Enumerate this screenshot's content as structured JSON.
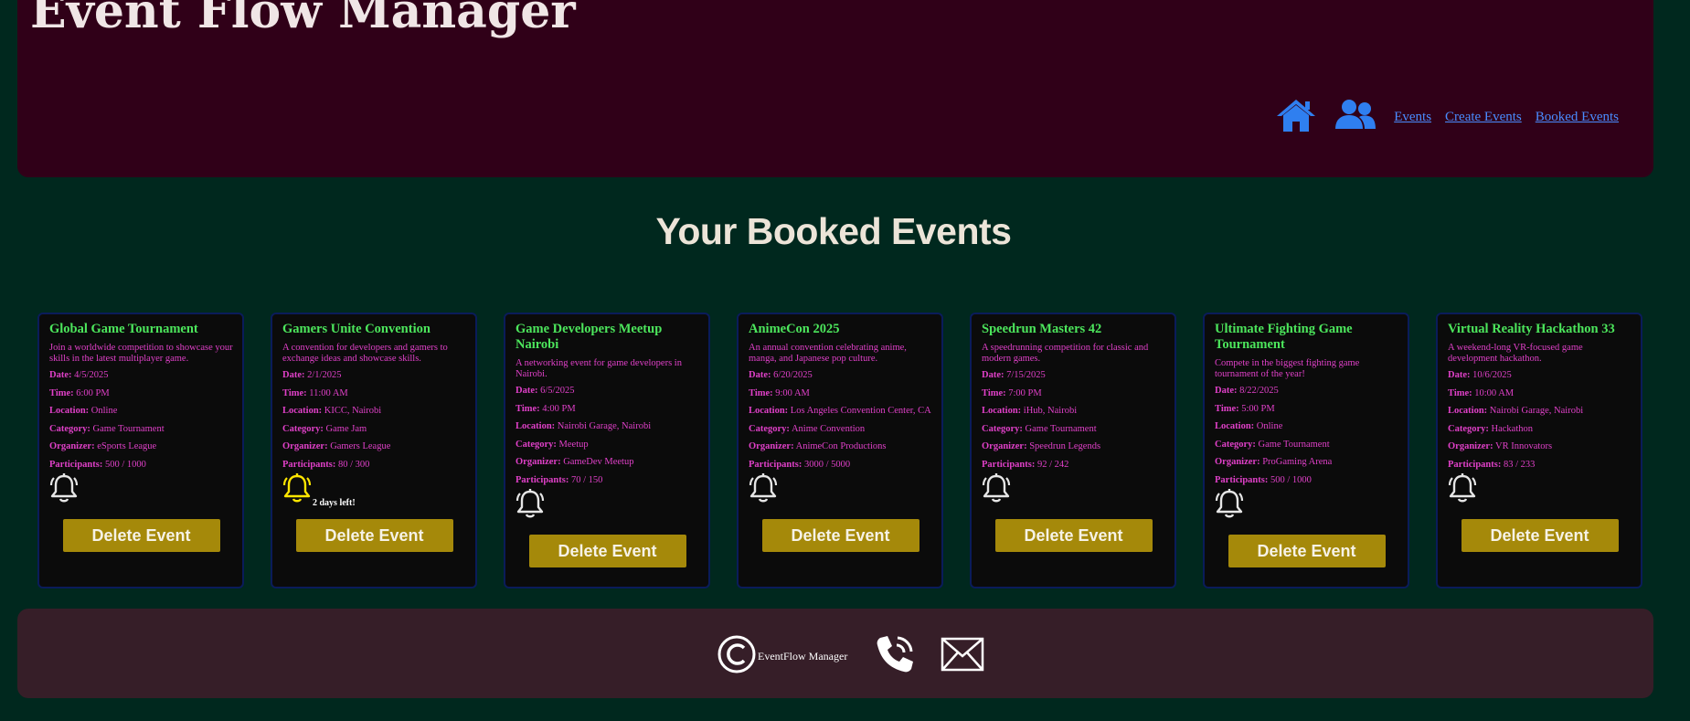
{
  "header": {
    "title": "Event Flow Manager",
    "nav": {
      "home_icon": "home-icon",
      "users_icon": "users-icon",
      "links": [
        "Events",
        "Create Events",
        "Booked Events"
      ]
    }
  },
  "page": {
    "heading": "Your Booked Events"
  },
  "labels": {
    "date": "Date:",
    "time": "Time:",
    "location": "Location:",
    "category": "Category:",
    "organizer": "Organizer:",
    "participants": "Participants:",
    "delete": "Delete Event"
  },
  "events": [
    {
      "title": "Global Game Tournament",
      "description": "Join a worldwide competition to showcase your skills in the latest multiplayer game.",
      "date": "4/5/2025",
      "time": "6:00 PM",
      "location": "Online",
      "category": "Game Tournament",
      "organizer": "eSports League",
      "participants": "500 / 1000",
      "bell_active": false,
      "countdown": ""
    },
    {
      "title": "Gamers Unite Convention",
      "description": "A convention for developers and gamers to exchange ideas and showcase skills.",
      "date": "2/1/2025",
      "time": "11:00 AM",
      "location": "KICC, Nairobi",
      "category": "Game Jam",
      "organizer": "Gamers League",
      "participants": "80 / 300",
      "bell_active": true,
      "countdown": "2 days left!"
    },
    {
      "title": "Game Developers Meetup Nairobi",
      "description": "A networking event for game developers in Nairobi.",
      "date": "6/5/2025",
      "time": "4:00 PM",
      "location": "Nairobi Garage, Nairobi",
      "category": "Meetup",
      "organizer": "GameDev Meetup",
      "participants": "70 / 150",
      "bell_active": false,
      "countdown": ""
    },
    {
      "title": "AnimeCon 2025",
      "description": "An annual convention celebrating anime, manga, and Japanese pop culture.",
      "date": "6/20/2025",
      "time": "9:00 AM",
      "location": "Los Angeles Convention Center, CA",
      "category": "Anime Convention",
      "organizer": "AnimeCon Productions",
      "participants": "3000 / 5000",
      "bell_active": false,
      "countdown": ""
    },
    {
      "title": "Speedrun Masters 42",
      "description": "A speedrunning competition for classic and modern games.",
      "date": "7/15/2025",
      "time": "7:00 PM",
      "location": "iHub, Nairobi",
      "category": "Game Tournament",
      "organizer": "Speedrun Legends",
      "participants": "92 / 242",
      "bell_active": false,
      "countdown": ""
    },
    {
      "title": "Ultimate Fighting Game Tournament",
      "description": "Compete in the biggest fighting game tournament of the year!",
      "date": "8/22/2025",
      "time": "5:00 PM",
      "location": "Online",
      "category": "Game Tournament",
      "organizer": "ProGaming Arena",
      "participants": "500 / 1000",
      "bell_active": false,
      "countdown": ""
    },
    {
      "title": "Virtual Reality Hackathon 33",
      "description": "A weekend-long VR-focused game development hackathon.",
      "date": "10/6/2025",
      "time": "10:00 AM",
      "location": "Nairobi Garage, Nairobi",
      "category": "Hackathon",
      "organizer": "VR Innovators",
      "participants": "83 / 233",
      "bell_active": false,
      "countdown": ""
    }
  ],
  "footer": {
    "copyright_icon": "copyright-icon",
    "copyright_text": "EventFlow Manager",
    "phone_icon": "phone-icon",
    "mail_icon": "mail-icon"
  },
  "colors": {
    "page_bg": "#00281e",
    "header_bg": "#300018",
    "footer_bg": "#361e28",
    "card_bg": "#0b0b0b",
    "title_green": "#4ce65c",
    "text_magenta": "#e040c8",
    "button_gold": "#a5890a",
    "link_blue": "#4a8cff",
    "bell_active": "#ffe600"
  }
}
